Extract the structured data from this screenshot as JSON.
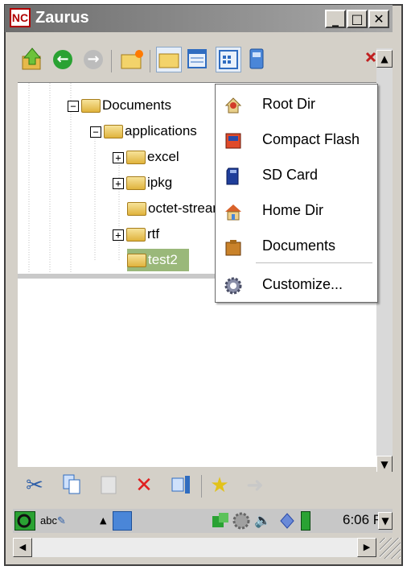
{
  "window": {
    "title": "Zaurus",
    "logo_text": "NC",
    "minimize_glyph": "_",
    "maximize_glyph": "□",
    "close_glyph": "✕"
  },
  "toolbar": {
    "icons": [
      "up-folder-icon",
      "back-icon",
      "forward-icon",
      "new-folder-icon",
      "open-folder-icon",
      "calendar-view-icon",
      "detail-view-icon",
      "storage-icon"
    ],
    "back_glyph": "←",
    "forward_glyph": "→"
  },
  "tree": {
    "rows": [
      {
        "label": "Documents",
        "expander": "−"
      },
      {
        "label": "applications",
        "expander": "−"
      },
      {
        "label": "excel",
        "expander": "+"
      },
      {
        "label": "ipkg",
        "expander": "+"
      },
      {
        "label": "octet-stream",
        "expander": ""
      },
      {
        "label": "rtf",
        "expander": "+"
      },
      {
        "label": "test2",
        "expander": "",
        "selected": true
      }
    ]
  },
  "menu": {
    "items": [
      {
        "label": "Root Dir",
        "icon": "root-dir-icon"
      },
      {
        "label": "Compact Flash",
        "icon": "compact-flash-icon"
      },
      {
        "label": "SD Card",
        "icon": "sd-card-icon"
      },
      {
        "label": "Home Dir",
        "icon": "home-icon"
      },
      {
        "label": "Documents",
        "icon": "documents-icon"
      },
      {
        "label": "Customize...",
        "icon": "gear-icon"
      }
    ]
  },
  "bottom_toolbar": {
    "icons": [
      "cut-icon",
      "copy-icon",
      "paste-icon",
      "delete-icon",
      "properties-icon",
      "bookmark-icon",
      "move-icon"
    ]
  },
  "taskbar": {
    "input_method": "abc",
    "time": "6:06 F"
  },
  "colors": {
    "selection": "#9ab87a",
    "title_gradient_start": "#6d6d6d",
    "delete_red": "#e02020"
  }
}
